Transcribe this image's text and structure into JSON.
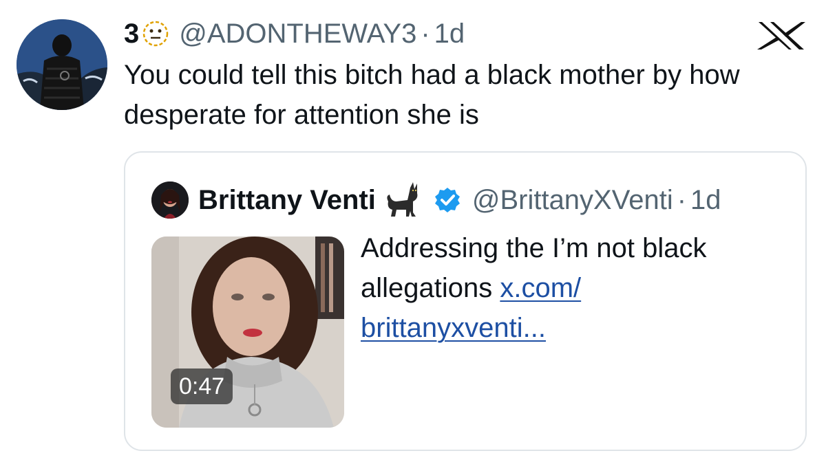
{
  "tweet": {
    "display_name": "3",
    "name_emoji": "neutral-face-icon",
    "handle": "@ADONTHEWAY3",
    "separator": "·",
    "time": "1d",
    "text": "You could tell this bitch had a black mother by how desperate for attention she is"
  },
  "brand": {
    "logo": "x-logo-icon"
  },
  "quote": {
    "display_name": "Brittany Venti",
    "name_emoji": "black-cat-icon",
    "verified_icon": "verified-badge-icon",
    "verified_color": "#1d9bf0",
    "handle": "@BrittanyXVenti",
    "separator": "·",
    "time": "1d",
    "text": "Addressing the I’m not black allegations ",
    "link_line1": "x.com/",
    "link_line2": "brittanyxventi...",
    "link_color": "#1d4fa3",
    "video_duration": "0:47"
  },
  "colors": {
    "text": "#0f1419",
    "secondary_text": "#536471",
    "card_border": "#dfe4e8"
  }
}
